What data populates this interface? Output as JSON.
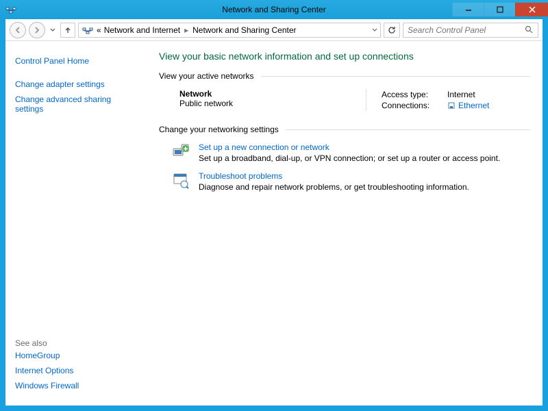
{
  "window": {
    "title": "Network and Sharing Center"
  },
  "nav": {
    "breadcrumb_prefix": "«",
    "crumb1": "Network and Internet",
    "crumb2": "Network and Sharing Center",
    "search_placeholder": "Search Control Panel"
  },
  "sidebar": {
    "home": "Control Panel Home",
    "adapter": "Change adapter settings",
    "advanced": "Change advanced sharing settings",
    "see_also": "See also",
    "homegroup": "HomeGroup",
    "internet_options": "Internet Options",
    "firewall": "Windows Firewall"
  },
  "main": {
    "heading": "View your basic network information and set up connections",
    "active_section": "View your active networks",
    "network_name": "Network",
    "network_type": "Public network",
    "access_label": "Access type:",
    "access_value": "Internet",
    "connections_label": "Connections:",
    "connection_value": "Ethernet",
    "change_section": "Change your networking settings",
    "setup_title": "Set up a new connection or network",
    "setup_desc": "Set up a broadband, dial-up, or VPN connection; or set up a router or access point.",
    "troubleshoot_title": "Troubleshoot problems",
    "troubleshoot_desc": "Diagnose and repair network problems, or get troubleshooting information."
  }
}
